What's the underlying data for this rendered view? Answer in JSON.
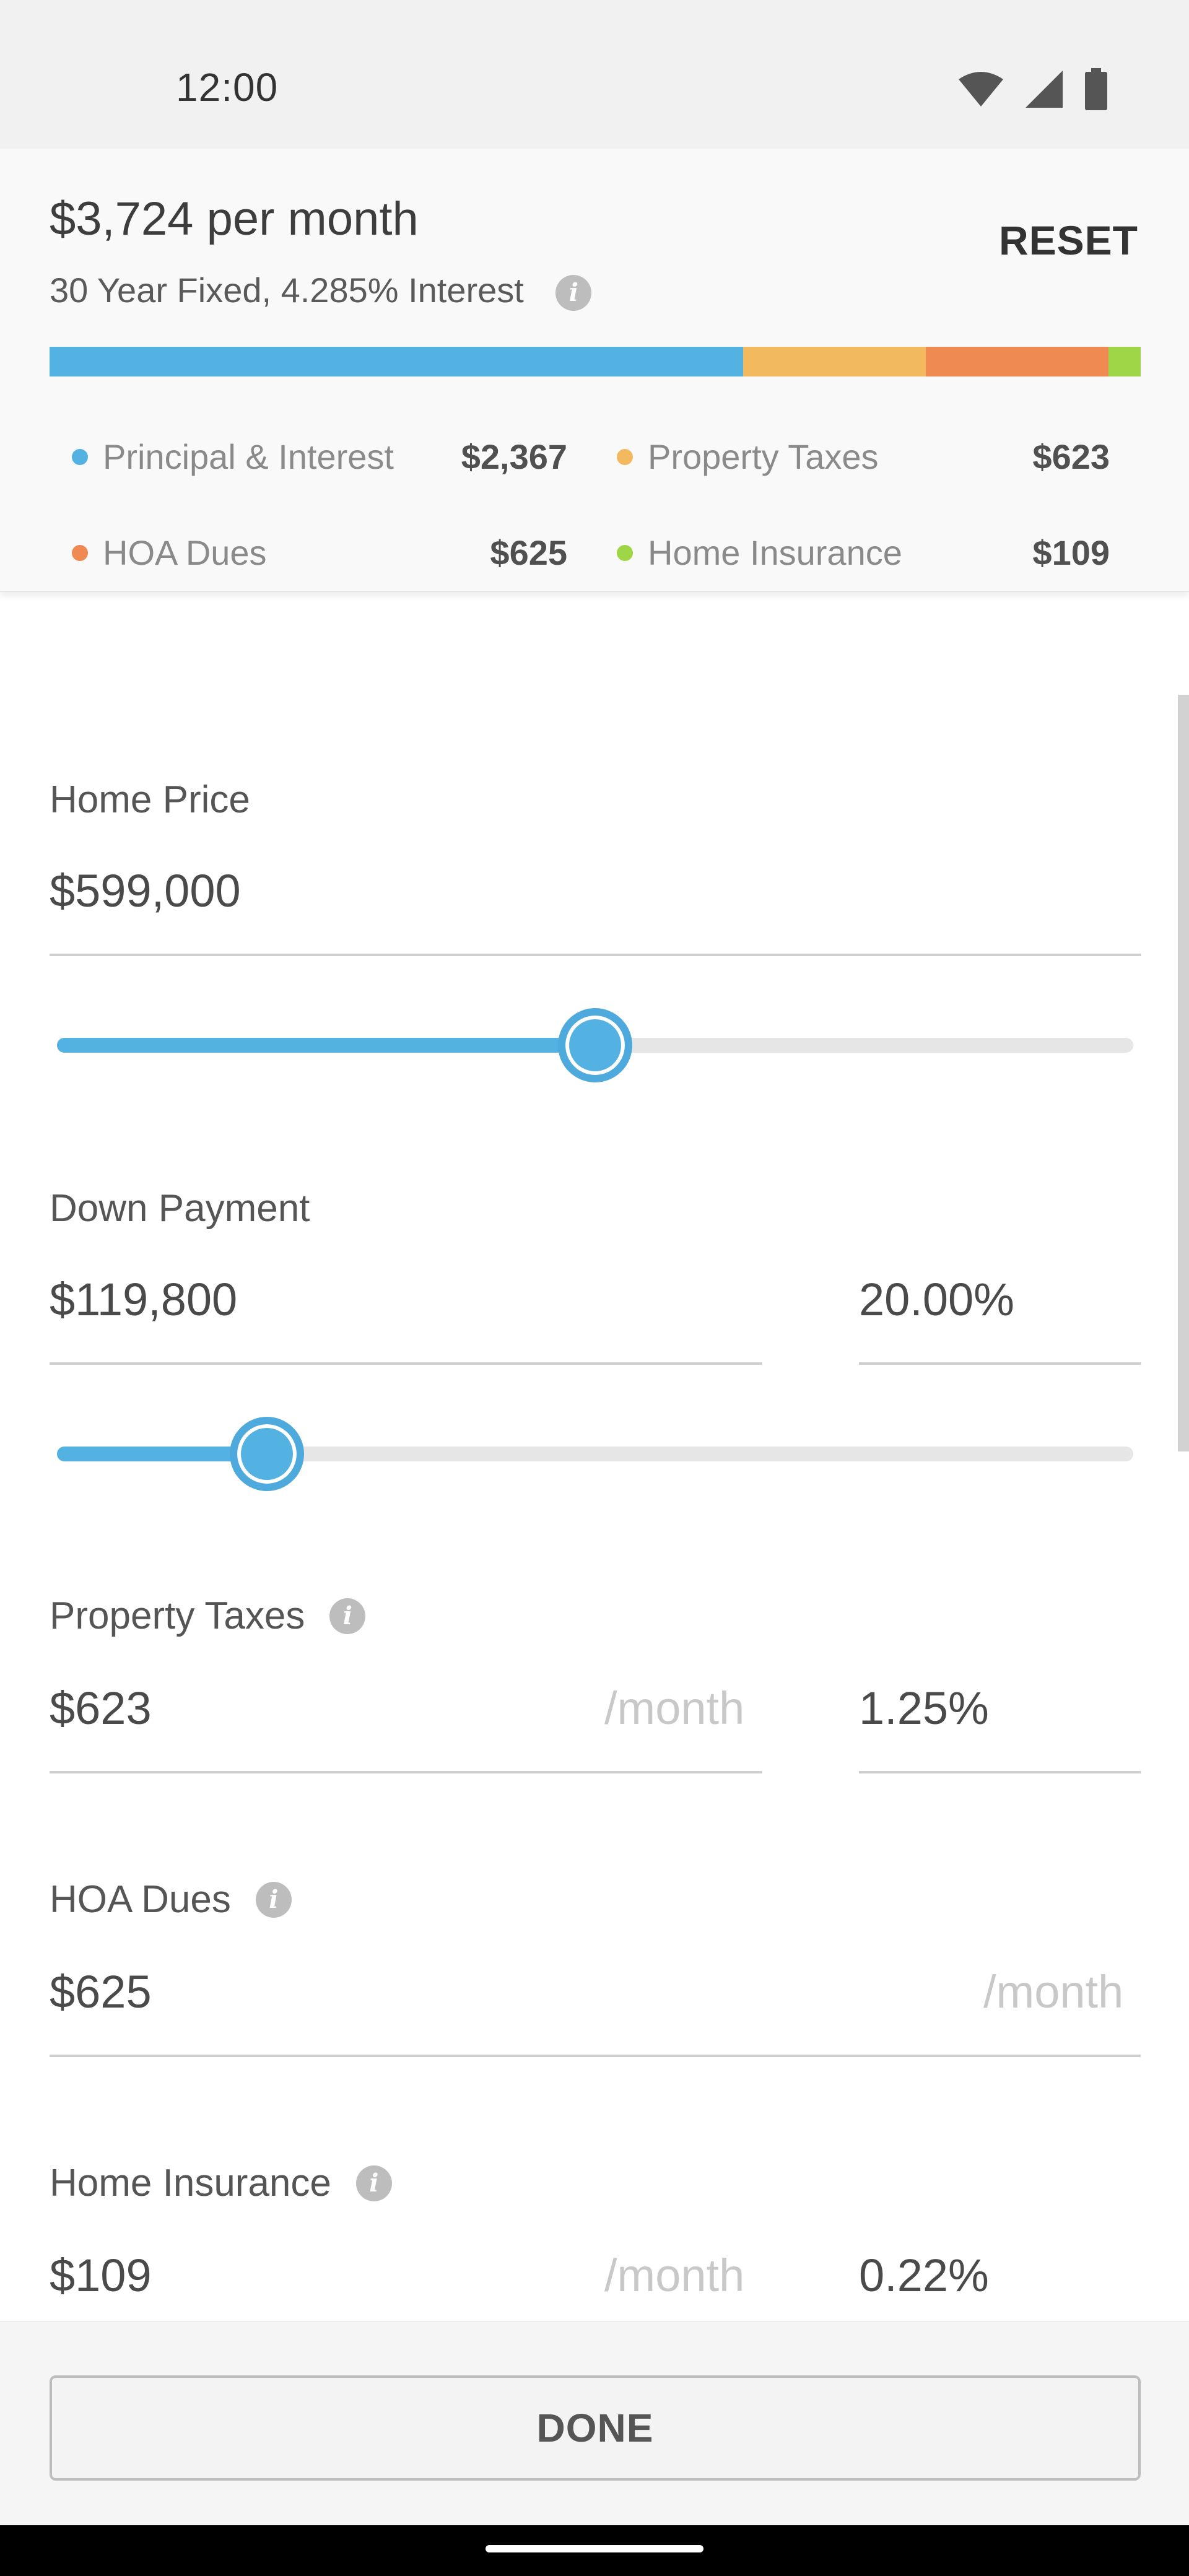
{
  "status_bar": {
    "time": "12:00",
    "icons": [
      "wifi-icon",
      "signal-icon",
      "battery-icon"
    ]
  },
  "summary": {
    "title": "$3,724 per month",
    "subtitle": "30 Year Fixed, 4.285% Interest",
    "reset_label": "RESET",
    "breakdown": [
      {
        "label": "Principal & Interest",
        "value": "$2,367",
        "amount": 2367,
        "color": "#54b2e3"
      },
      {
        "label": "Property Taxes",
        "value": "$623",
        "amount": 623,
        "color": "#f3b95f"
      },
      {
        "label": "HOA Dues",
        "value": "$625",
        "amount": 625,
        "color": "#ef8a52"
      },
      {
        "label": "Home Insurance",
        "value": "$109",
        "amount": 109,
        "color": "#9fd648"
      }
    ]
  },
  "form": {
    "home_price": {
      "label": "Home Price",
      "value": "$599,000",
      "slider_fraction": 0.5
    },
    "down_payment": {
      "label": "Down Payment",
      "value": "$119,800",
      "percent": "20.00%",
      "slider_fraction": 0.195
    },
    "property_taxes": {
      "label": "Property Taxes",
      "value": "$623",
      "unit": "/month",
      "percent": "1.25%"
    },
    "hoa_dues": {
      "label": "HOA Dues",
      "value": "$625",
      "unit": "/month"
    },
    "home_insurance": {
      "label": "Home Insurance",
      "value": "$109",
      "unit": "/month",
      "percent": "0.22%"
    }
  },
  "done_label": "DONE",
  "colors": {
    "accent": "#54b2e3"
  }
}
